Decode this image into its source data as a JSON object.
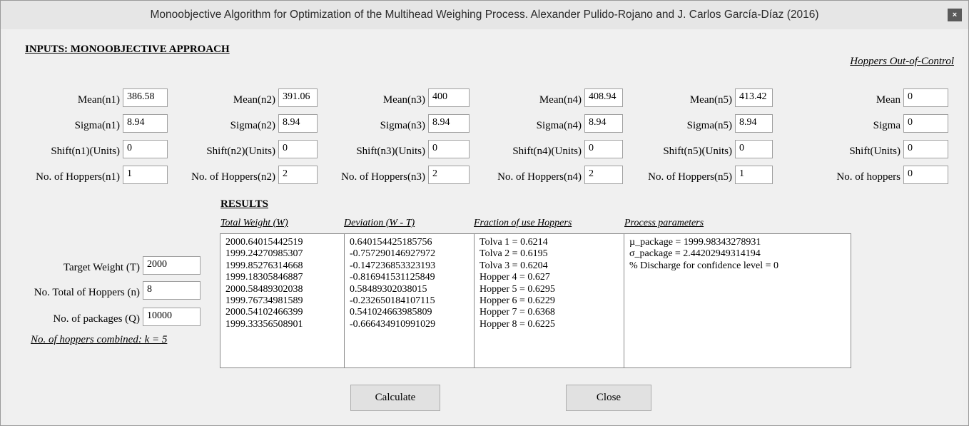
{
  "window": {
    "title": "Monoobjective Algorithm for Optimization of the Multihead Weighing Process. Alexander Pulido-Rojano and J. Carlos García-Díaz (2016)",
    "close_label": "×"
  },
  "inputs": {
    "heading": "INPUTS: MONOOBJECTIVE APPROACH",
    "out_of_control_heading": "Hoppers Out-of-Control",
    "groups": [
      {
        "mean_label": "Mean(n1)",
        "mean": "386.58",
        "sigma_label": "Sigma(n1)",
        "sigma": "8.94",
        "shift_label": "Shift(n1)(Units)",
        "shift": "0",
        "hoppers_label": "No. of Hoppers(n1)",
        "hoppers": "1"
      },
      {
        "mean_label": "Mean(n2)",
        "mean": "391.06",
        "sigma_label": "Sigma(n2)",
        "sigma": "8.94",
        "shift_label": "Shift(n2)(Units)",
        "shift": "0",
        "hoppers_label": "No. of Hoppers(n2)",
        "hoppers": "2"
      },
      {
        "mean_label": "Mean(n3)",
        "mean": "400",
        "sigma_label": "Sigma(n3)",
        "sigma": "8.94",
        "shift_label": "Shift(n3)(Units)",
        "shift": "0",
        "hoppers_label": "No. of Hoppers(n3)",
        "hoppers": "2"
      },
      {
        "mean_label": "Mean(n4)",
        "mean": "408.94",
        "sigma_label": "Sigma(n4)",
        "sigma": "8.94",
        "shift_label": "Shift(n4)(Units)",
        "shift": "0",
        "hoppers_label": "No. of Hoppers(n4)",
        "hoppers": "2"
      },
      {
        "mean_label": "Mean(n5)",
        "mean": "413.42",
        "sigma_label": "Sigma(n5)",
        "sigma": "8.94",
        "shift_label": "Shift(n5)(Units)",
        "shift": "0",
        "hoppers_label": "No. of Hoppers(n5)",
        "hoppers": "1"
      },
      {
        "mean_label": "Mean",
        "mean": "0",
        "sigma_label": "Sigma",
        "sigma": "0",
        "shift_label": "Shift(Units)",
        "shift": "0",
        "hoppers_label": "No. of hoppers",
        "hoppers": "0"
      }
    ]
  },
  "left": {
    "target_label": "Target Weight (T)",
    "target": "2000",
    "total_hoppers_label": "No. Total of Hoppers (n)",
    "total_hoppers": "8",
    "packages_label": "No. of packages (Q)",
    "packages": "10000",
    "combined_text": "No. of hoppers combined: k = 5"
  },
  "results": {
    "heading": "RESULTS",
    "total_weight_header": "Total Weight (W)",
    "deviation_header": "Deviation (W - T)",
    "fraction_header": "Fraction of use Hoppers",
    "process_header": "Process parameters",
    "total_weight": [
      "2000.64015442519",
      "1999.24270985307",
      "1999.85276314668",
      "1999.18305846887",
      "2000.58489302038",
      "1999.76734981589",
      "2000.54102466399",
      "1999.33356508901"
    ],
    "deviation": [
      "0.640154425185756",
      "-0.757290146927972",
      "-0.147236853323193",
      "-0.816941531125849",
      "0.58489302038015",
      "-0.232650184107115",
      "0.541024663985809",
      "-0.666434910991029"
    ],
    "fraction": [
      "Tolva 1 = 0.6214",
      "Tolva 2 = 0.6195",
      "Tolva 3 = 0.6204",
      "Hopper 4 = 0.627",
      "Hopper 5 = 0.6295",
      "Hopper 6 = 0.6229",
      "Hopper 7 = 0.6368",
      "Hopper 8 = 0.6225"
    ],
    "process": [
      "µ_package = 1999.98343278931",
      "σ_package = 2.44202949314194",
      "% Discharge for confidence level = 0"
    ]
  },
  "buttons": {
    "calculate": "Calculate",
    "close": "Close"
  }
}
